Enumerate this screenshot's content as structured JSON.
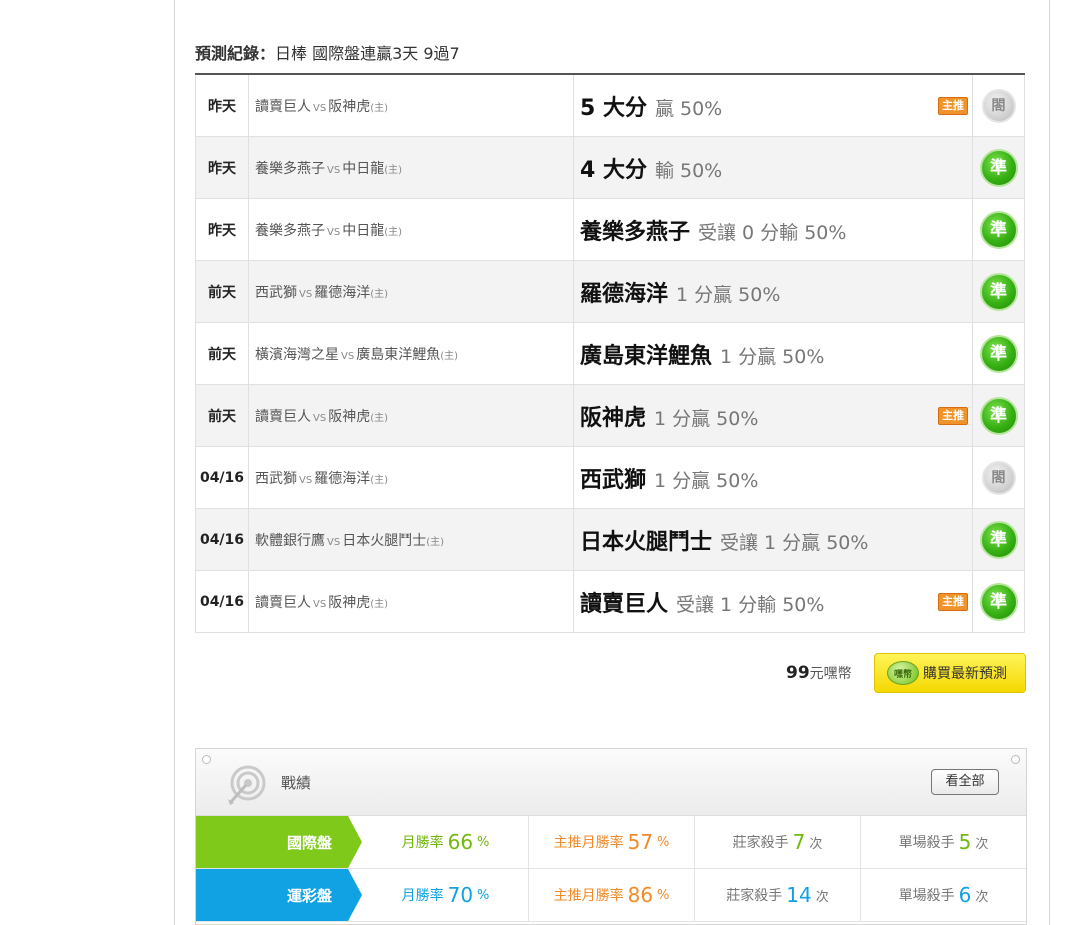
{
  "section": {
    "title_bold": "預測紀錄：",
    "title_rest": "日棒 國際盤連贏3天 9過7"
  },
  "records": [
    {
      "date": "昨天",
      "team_a": "讀賣巨人",
      "vs": "VS",
      "team_b": "阪神虎",
      "host": "(主)",
      "pick": "5 大分",
      "pick_extra": "贏 50%",
      "tag": "主推",
      "result": "閤",
      "result_type": "lose"
    },
    {
      "date": "昨天",
      "team_a": "養樂多燕子",
      "vs": "VS",
      "team_b": "中日龍",
      "host": "(主)",
      "pick": "4 大分",
      "pick_extra": "輸 50%",
      "tag": "",
      "result": "準",
      "result_type": "win"
    },
    {
      "date": "昨天",
      "team_a": "養樂多燕子",
      "vs": "VS",
      "team_b": "中日龍",
      "host": "(主)",
      "pick": "養樂多燕子",
      "pick_extra": "受讓 0 分輸 50%",
      "tag": "",
      "result": "準",
      "result_type": "win"
    },
    {
      "date": "前天",
      "team_a": "西武獅",
      "vs": "VS",
      "team_b": "羅德海洋",
      "host": "(主)",
      "pick": "羅德海洋",
      "pick_extra": "1 分贏 50%",
      "tag": "",
      "result": "準",
      "result_type": "win"
    },
    {
      "date": "前天",
      "team_a": "橫濱海灣之星",
      "vs": "VS",
      "team_b": "廣島東洋鯉魚",
      "host": "(主)",
      "pick": "廣島東洋鯉魚",
      "pick_extra": "1 分贏 50%",
      "tag": "",
      "result": "準",
      "result_type": "win"
    },
    {
      "date": "前天",
      "team_a": "讀賣巨人",
      "vs": "VS",
      "team_b": "阪神虎",
      "host": "(主)",
      "pick": "阪神虎",
      "pick_extra": "1 分贏 50%",
      "tag": "主推",
      "result": "準",
      "result_type": "win"
    },
    {
      "date": "04/16",
      "team_a": "西武獅",
      "vs": "VS",
      "team_b": "羅德海洋",
      "host": "(主)",
      "pick": "西武獅",
      "pick_extra": "1 分贏 50%",
      "tag": "",
      "result": "閤",
      "result_type": "lose"
    },
    {
      "date": "04/16",
      "team_a": "軟體銀行鷹",
      "vs": "VS",
      "team_b": "日本火腿鬥士",
      "host": "(主)",
      "pick": "日本火腿鬥士",
      "pick_extra": "受讓 1 分贏 50%",
      "tag": "",
      "result": "準",
      "result_type": "win"
    },
    {
      "date": "04/16",
      "team_a": "讀賣巨人",
      "vs": "VS",
      "team_b": "阪神虎",
      "host": "(主)",
      "pick": "讀賣巨人",
      "pick_extra": "受讓 1 分輸 50%",
      "tag": "主推",
      "result": "準",
      "result_type": "win"
    }
  ],
  "purchase": {
    "price_num": "99",
    "price_unit": "元嘿幣",
    "coin_text": "嘿幣",
    "button_label": "購買最新預測"
  },
  "stats": {
    "label": "戰績",
    "view_all": "看全部",
    "rows": [
      {
        "category": "國際盤",
        "monthly_label": "月勝率",
        "monthly": "66",
        "pct": "%",
        "main_label": "主推月勝率",
        "main": "57",
        "killer_label": "莊家殺手",
        "killer": "7",
        "times": "次",
        "single_label": "單場殺手",
        "single": "5",
        "times2": "次"
      },
      {
        "category": "運彩盤",
        "monthly_label": "月勝率",
        "monthly": "70",
        "pct": "%",
        "main_label": "主推月勝率",
        "main": "86",
        "killer_label": "莊家殺手",
        "killer": "14",
        "times": "次",
        "single_label": "單場殺手",
        "single": "6",
        "times2": "次"
      }
    ]
  },
  "colors": {
    "green_accent": "#7ec91a",
    "blue_accent": "#10a2e3",
    "orange_accent": "#f08a2a",
    "win_badge": "#37b014",
    "button_yellow": "#f5d800"
  }
}
